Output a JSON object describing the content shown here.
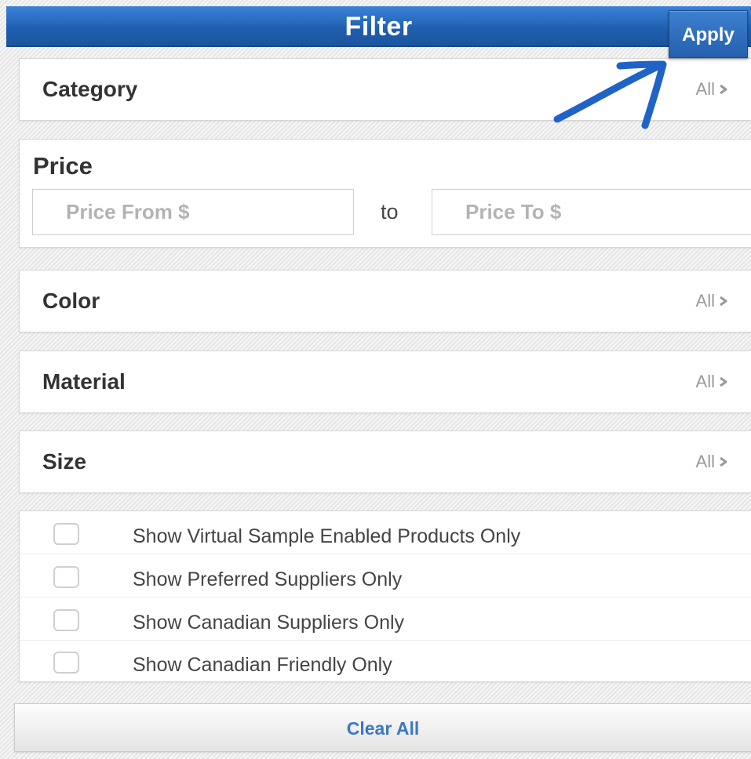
{
  "header": {
    "title": "Filter",
    "apply_label": "Apply"
  },
  "filters": {
    "category": {
      "label": "Category",
      "value": "All"
    },
    "color": {
      "label": "Color",
      "value": "All"
    },
    "material": {
      "label": "Material",
      "value": "All"
    },
    "size": {
      "label": "Size",
      "value": "All"
    }
  },
  "price": {
    "label": "Price",
    "from_value": "",
    "from_placeholder": "Price From $",
    "to_label": "to",
    "to_value": "",
    "to_placeholder": "Price To $"
  },
  "options": [
    {
      "label": "Show Virtual Sample Enabled Products Only",
      "checked": false
    },
    {
      "label": "Show Preferred Suppliers Only",
      "checked": false
    },
    {
      "label": "Show Canadian Suppliers Only",
      "checked": false
    },
    {
      "label": "Show Canadian Friendly Only",
      "checked": false
    }
  ],
  "footer": {
    "clear_label": "Clear All"
  },
  "colors": {
    "header_blue": "#1f5eae",
    "annotation_blue": "#1f63c7",
    "link_blue": "#3b78c4"
  },
  "icons": {
    "nav_indicator": "chevron-right-icon",
    "annotation": "arrow-annotation-icon"
  }
}
